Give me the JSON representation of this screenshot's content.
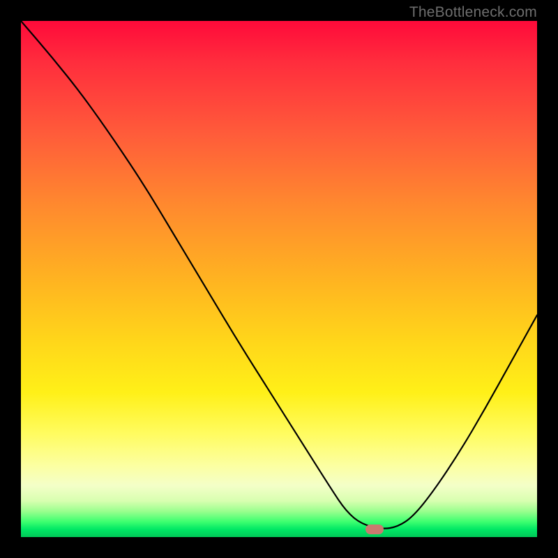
{
  "watermark": {
    "text": "TheBottleneck.com"
  },
  "marker": {
    "x_frac": 0.685,
    "y_frac": 0.985,
    "color": "#c97a6f"
  },
  "gradient_note": "red→orange→yellow→green vertical heatmap background",
  "chart_data": {
    "type": "line",
    "title": "",
    "xlabel": "",
    "ylabel": "",
    "xlim": [
      0,
      1
    ],
    "ylim": [
      0,
      1
    ],
    "note": "Axes unlabeled; x and y are normalized fractions of plot area. Curve descends from top-left, flattens near bottom around x≈0.63–0.72, then rises to the right edge. Values visually estimated.",
    "series": [
      {
        "name": "curve",
        "x": [
          0.0,
          0.06,
          0.12,
          0.18,
          0.24,
          0.3,
          0.36,
          0.42,
          0.48,
          0.54,
          0.6,
          0.63,
          0.66,
          0.7,
          0.73,
          0.76,
          0.8,
          0.85,
          0.9,
          0.95,
          1.0
        ],
        "y": [
          1.0,
          0.93,
          0.855,
          0.77,
          0.68,
          0.58,
          0.48,
          0.38,
          0.285,
          0.19,
          0.095,
          0.05,
          0.025,
          0.015,
          0.02,
          0.04,
          0.09,
          0.165,
          0.25,
          0.34,
          0.43
        ]
      }
    ],
    "markers": [
      {
        "name": "highlight",
        "x": 0.685,
        "y": 0.015,
        "shape": "rounded-rect",
        "color": "#c97a6f"
      }
    ]
  }
}
